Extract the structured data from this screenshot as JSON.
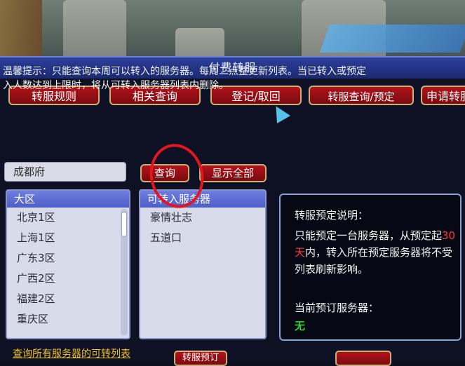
{
  "window": {
    "title": "付费转服"
  },
  "top_buttons": [
    {
      "label": "转服规则"
    },
    {
      "label": "相关查询"
    },
    {
      "label": "登记/取回"
    },
    {
      "label": "转服查询/预定"
    },
    {
      "label": "申请转服"
    }
  ],
  "tip": {
    "line1": "温馨提示：只能查询本周可以转入的服务器。每周二",
    "line1b": "点整更新列表。当已转入或预定",
    "line2": "入人数达到上限时，将从可转入服务器列表内删除。"
  },
  "search": {
    "value": "成都府",
    "query_label": "查询",
    "show_all_label": "显示全部"
  },
  "region_list": {
    "header": "大区",
    "items": [
      "北京1区",
      "上海1区",
      "广东3区",
      "广西2区",
      "福建2区",
      "重庆区"
    ]
  },
  "server_list": {
    "header": "可转入服务器",
    "items": [
      "豪情壮志",
      "五道口"
    ]
  },
  "booking_info": {
    "title": "转服预定说明：",
    "desc_prefix": "只能预定一台服务器，从预定起",
    "desc_highlight": "30天",
    "desc_suffix": "内，转入所在预定服务器将不受列表刷新影响。",
    "current_label": "当前预订服务器：",
    "current_value": "无"
  },
  "bottom": {
    "link": "查询所有服务器的可转列表",
    "button1": "转服预订"
  },
  "colors": {
    "accent_red": "#b0141a",
    "title_blue": "#2b3f9c",
    "highlight": "#ff3a3a",
    "status_green": "#2fd62f"
  }
}
